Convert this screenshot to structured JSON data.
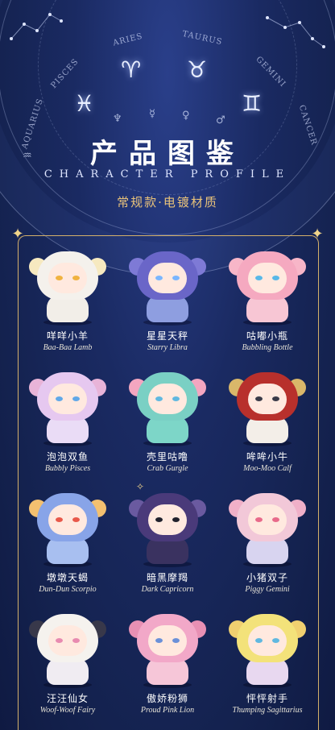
{
  "header": {
    "title_zh": "产品图鉴",
    "title_en": "CHARACTER PROFILE",
    "subtitle": "常规款·电镀材质"
  },
  "wheel": {
    "labels": [
      "AQUARIUS",
      "PISCES",
      "ARIES",
      "TAURUS",
      "GEMINI",
      "CANCER"
    ],
    "symbols": [
      "♓",
      "♈",
      "♉",
      "♊"
    ],
    "planets": [
      "♆",
      "☿",
      "♀",
      "♂",
      "♒"
    ]
  },
  "colors": {
    "background": "#14224f",
    "gold": "#d4b06a",
    "subtitle": "#e8c27a"
  },
  "products": [
    {
      "zh": "咩咩小羊",
      "en": "Baa-Baa Lamb",
      "hood": "#f4f1ec",
      "body": "#f2eee8",
      "ear": "#f6e9c0",
      "eye": "#f0b340"
    },
    {
      "zh": "星星天秤",
      "en": "Starry Libra",
      "hood": "#6a66c8",
      "body": "#8e9ee0",
      "ear": "#7e7ad6",
      "eye": "#7ab6ff"
    },
    {
      "zh": "咕嘟小瓶",
      "en": "Bubbling Bottle",
      "hood": "#f5a9c0",
      "body": "#f7c6d4",
      "ear": "#f7b6c8",
      "eye": "#58b8e8"
    },
    {
      "zh": "泡泡双鱼",
      "en": "Bubbly Pisces",
      "hood": "#e6c8f0",
      "body": "#eadcf6",
      "ear": "#e8b4d8",
      "eye": "#60a8e8"
    },
    {
      "zh": "壳里咕噜",
      "en": "Crab Gurgle",
      "hood": "#7ad0c4",
      "body": "#7dd6c8",
      "ear": "#f3a6c0",
      "eye": "#60b8e0"
    },
    {
      "zh": "哞哞小牛",
      "en": "Moo-Moo Calf",
      "hood": "#b8302c",
      "body": "#f3eee8",
      "ear": "#d9b76a",
      "eye": "#3a3a48"
    },
    {
      "zh": "墩墩天蝎",
      "en": "Dun-Dun Scorpio",
      "hood": "#88a4e8",
      "body": "#a8bff0",
      "ear": "#f3c070",
      "eye": "#e8584a"
    },
    {
      "zh": "暗黑摩羯",
      "en": "Dark Capricorn",
      "hood": "#4a3a7a",
      "body": "#3a3260",
      "ear": "#6a5aa0",
      "eye": "#20202c"
    },
    {
      "zh": "小猪双子",
      "en": "Piggy Gemini",
      "hood": "#f2c8d8",
      "body": "#d8d4f0",
      "ear": "#f0b0c8",
      "eye": "#e86a8a"
    },
    {
      "zh": "汪汪仙女",
      "en": "Woof-Woof Fairy",
      "hood": "#f5f2ee",
      "body": "#f0ecf2",
      "ear": "#38384a",
      "eye": "#e88ab0"
    },
    {
      "zh": "傲娇粉狮",
      "en": "Proud Pink Lion",
      "hood": "#f2a8c8",
      "body": "#f6c6d8",
      "ear": "#e890b4",
      "eye": "#6a90d8"
    },
    {
      "zh": "怦怦射手",
      "en": "Thumping Sagittarius",
      "hood": "#f3e27a",
      "body": "#e8d8f0",
      "ear": "#f0d070",
      "eye": "#60b8e0"
    }
  ]
}
